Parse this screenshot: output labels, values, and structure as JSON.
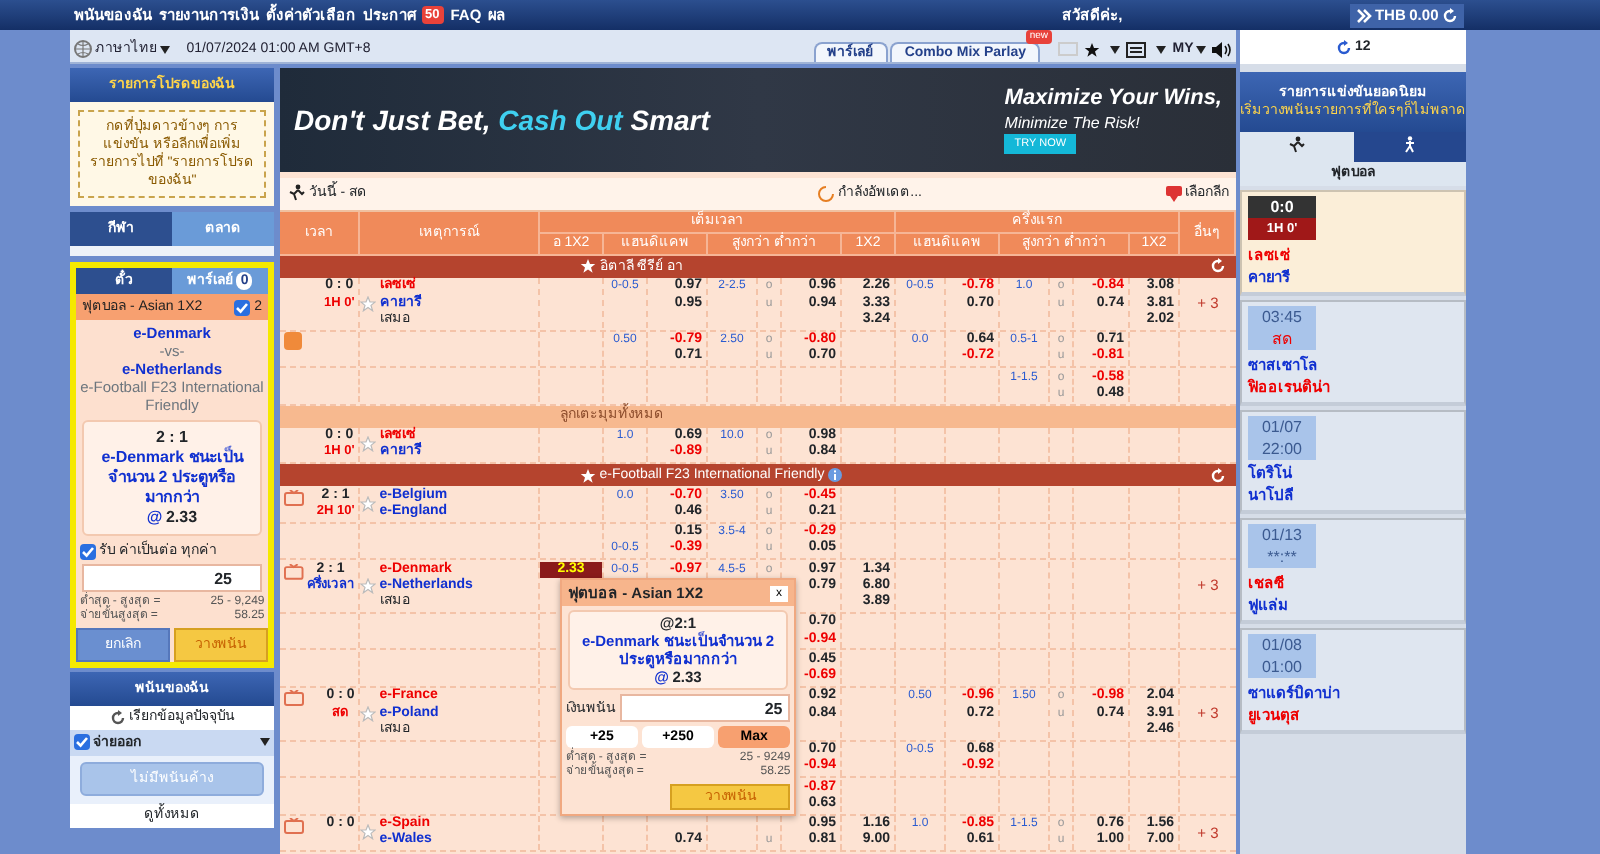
{
  "top_nav": {
    "items": [
      {
        "label": "พนันของฉัน"
      },
      {
        "label": "รายงานการเงิน"
      },
      {
        "label": "ตั้งค่าตัวเลือก"
      },
      {
        "label": "ประกาศ",
        "badge": "50"
      },
      {
        "label": "FAQ"
      },
      {
        "label": "ผล"
      }
    ],
    "greeting": "สวัสดีค่ะ,",
    "currency": "THB",
    "balance": "0.00"
  },
  "toolbar": {
    "language": "ภาษาไทย",
    "datetime": "01/07/2024 01:00 AM GMT+8",
    "tabs": [
      {
        "label": "พาร์เลย์"
      },
      {
        "label": "Combo Mix Parlay",
        "badge": "new"
      }
    ],
    "odds_type": "MY"
  },
  "favorites": {
    "title": "รายการโปรดของฉัน",
    "hint": "กดที่ปุ่มดาวข้างๆ การแข่งขัน หรือลีกเพื่อเพิ่มรายการไปที่ \"รายการโปรดของฉัน\""
  },
  "sport_tabs": [
    {
      "label": "กีฬา",
      "selected": true
    },
    {
      "label": "ตลาด",
      "selected": false
    }
  ],
  "bet_slip": {
    "tabs": [
      {
        "label": "ตั๋ว",
        "selected": true
      },
      {
        "label": "พาร์เลย์",
        "selected": false,
        "count": "0"
      }
    ],
    "market": "ฟุตบอล - Asian 1X2",
    "checked": true,
    "count": "2",
    "home": "e-Denmark",
    "vs": "-vs-",
    "away": "e-Netherlands",
    "league": "e-Football F23 International Friendly",
    "score": "2 : 1",
    "selection": "e-Denmark ชนะเป็นจำนวน 2 ประตูหรือมากกว่า",
    "at": "@",
    "odds": "2.33",
    "accept_any_odds": {
      "label": "รับ ค่าเป็นต่อ ทุกค่า",
      "checked": true
    },
    "stake": "25",
    "limits": [
      {
        "label": "ต่ำสุด - สูงสุด =",
        "value": "25 - 9,249"
      },
      {
        "label": "จ่ายขั้นสูงสุด =",
        "value": "58.25"
      }
    ],
    "buttons": [
      "ยกเลิก",
      "วางพนัน"
    ]
  },
  "my_bets": {
    "title": "พนันของฉัน",
    "refresh": "เรียกข้อมูลปัจจุบัน",
    "filter": {
      "label": "จ่ายออก",
      "checked": true
    },
    "empty_button": "ไม่มีพนันค้าง",
    "view_all": "ดูทั้งหมด"
  },
  "banner": {
    "headline": "Don't Just Bet, ",
    "highlight": "Cash Out",
    "tail": " Smart",
    "slogan_1": "Maximize Your Wins,",
    "slogan_2": "Minimize The Risk!",
    "cta": "TRY NOW"
  },
  "events_bar": {
    "title": "วันนี้ - สด",
    "status": "กำลังอัพเดต...",
    "league_filter": "เลือกลีก"
  },
  "table": {
    "columns": {
      "time": "เวลา",
      "event": "เหตุการณ์",
      "full_time": "เต็มเวลา",
      "first_half": "ครึ่งแรก",
      "more": "อื่นๆ",
      "ft_sub": [
        "อ 1X2",
        "แฮนดิแคพ",
        "สูงกว่า ต่ำกว่า",
        "1X2"
      ],
      "ht_sub": [
        "แฮนดิแคพ",
        "สูงกว่า ต่ำกว่า",
        "1X2"
      ]
    },
    "rows": [
      {
        "kind": "league",
        "name": "อิตาลี ซีรีย์ อา",
        "info": false
      },
      {
        "kind": "match",
        "score": "0 : 0",
        "period": "1H 0'",
        "half_time": false,
        "tv": false,
        "teams": [
          {
            "name": "เลซเซ่",
            "favorite": true
          },
          {
            "name": "คายารี",
            "favorite": false
          }
        ],
        "draw": "เสมอ",
        "more": "+ 3",
        "lines": [
          {
            "has_badge": false,
            "hdp": [
              {
                "line": "0-0.5",
                "odds": "0.97"
              },
              {
                "odds": "0.95"
              }
            ],
            "ou": [
              {
                "line": "2-2.5",
                "side": "o",
                "odds": "0.96"
              },
              {
                "side": "u",
                "odds": "0.94"
              }
            ],
            "x12": [
              "2.26",
              "3.33",
              "3.24"
            ],
            "ht_hdp": [
              {
                "line": "0-0.5",
                "odds": "-0.78"
              },
              {
                "odds": "0.70"
              }
            ],
            "ht_ou": [
              {
                "line": "1.0",
                "side": "o",
                "odds": "-0.84"
              },
              {
                "side": "u",
                "odds": "0.74"
              }
            ],
            "ht_x12": [
              "3.08",
              "3.81",
              "2.02"
            ]
          },
          {
            "has_badge": true,
            "hdp": [
              {
                "line": "0.50",
                "odds": "-0.79"
              },
              {
                "odds": "0.71"
              }
            ],
            "ou": [
              {
                "line": "2.50",
                "side": "o",
                "odds": "-0.80"
              },
              {
                "side": "u",
                "odds": "0.70"
              }
            ],
            "ht_hdp": [
              {
                "line": "0.0",
                "odds": "0.64"
              },
              {
                "odds": "-0.72"
              }
            ],
            "ht_ou": [
              {
                "line": "0.5-1",
                "side": "o",
                "odds": "0.71"
              },
              {
                "side": "u",
                "odds": "-0.81"
              }
            ]
          },
          {
            "has_badge": false,
            "ht_ou": [
              {
                "line": "1-1.5",
                "side": "o",
                "odds": "-0.58"
              },
              {
                "side": "u",
                "odds": "0.48"
              }
            ]
          }
        ]
      },
      {
        "kind": "band",
        "name": "ลูกเตะมุมทั้งหมด"
      },
      {
        "kind": "match",
        "score": "0 : 0",
        "period": "1H 0'",
        "half_time": false,
        "tv": false,
        "teams": [
          {
            "name": "เลซเซ่",
            "favorite": true
          },
          {
            "name": "คายารี",
            "favorite": false
          }
        ],
        "lines": [
          {
            "has_badge": false,
            "hdp": [
              {
                "line": "1.0",
                "odds": "0.69"
              },
              {
                "odds": "-0.89"
              }
            ],
            "ou": [
              {
                "line": "10.0",
                "side": "o",
                "odds": "0.98"
              },
              {
                "side": "u",
                "odds": "0.84"
              }
            ]
          }
        ]
      },
      {
        "kind": "league",
        "name": "e-Football F23 International Friendly",
        "info": true
      },
      {
        "kind": "match",
        "score": "2 : 1",
        "period": "2H 10'",
        "half_time": false,
        "tv": true,
        "teams": [
          {
            "name": "e-Belgium",
            "favorite": false
          },
          {
            "name": "e-England",
            "favorite": false
          }
        ],
        "lines": [
          {
            "has_badge": false,
            "hdp": [
              {
                "line": "0.0",
                "odds": "-0.70"
              },
              {
                "odds": "0.46"
              }
            ],
            "ou": [
              {
                "line": "3.50",
                "side": "o",
                "odds": "-0.45"
              },
              {
                "side": "u",
                "odds": "0.21"
              }
            ]
          },
          {
            "has_badge": false,
            "hdp": [
              {
                "odds": "0.15"
              },
              {
                "line": "0-0.5",
                "odds": "-0.39"
              }
            ],
            "ou": [
              {
                "line": "3.5-4",
                "side": "o",
                "odds": "-0.29"
              },
              {
                "side": "u",
                "odds": "0.05"
              }
            ]
          }
        ]
      },
      {
        "kind": "match",
        "score": "2 : 1",
        "period": "ครึ่งเวลา",
        "half_time": true,
        "tv": true,
        "teams": [
          {
            "name": "e-Denmark",
            "favorite": true
          },
          {
            "name": "e-Netherlands",
            "favorite": false
          }
        ],
        "draw": "เสมอ",
        "more": "+ 3",
        "lines": [
          {
            "has_badge": false,
            "pick": {
              "value": "2.33",
              "selected": true
            },
            "hdp": [
              {
                "line": "0-0.5",
                "odds": "-0.97"
              }
            ],
            "ou": [
              {
                "line": "4.5-5",
                "side": "o",
                "odds": "0.97"
              },
              {
                "odds": "0.79"
              }
            ],
            "x12": [
              "1.34",
              "6.80",
              "3.89"
            ]
          },
          {
            "has_badge": false,
            "ou": [
              {
                "odds": "0.70"
              },
              {
                "odds": "-0.94"
              }
            ]
          },
          {
            "has_badge": false,
            "ou": [
              {
                "odds": "0.45"
              },
              {
                "odds": "-0.69"
              }
            ]
          }
        ]
      },
      {
        "kind": "match",
        "score": "0 : 0",
        "period": "สด",
        "half_time": false,
        "tv": true,
        "teams": [
          {
            "name": "e-France",
            "favorite": true
          },
          {
            "name": "e-Poland",
            "favorite": false
          }
        ],
        "draw": "เสมอ",
        "more": "+ 3",
        "lines": [
          {
            "has_badge": false,
            "ou": [
              {
                "odds": "0.92"
              },
              {
                "odds": "0.84"
              }
            ],
            "ht_hdp": [
              {
                "line": "0.50",
                "odds": "-0.96"
              },
              {
                "odds": "0.72"
              }
            ],
            "ht_ou": [
              {
                "line": "1.50",
                "side": "o",
                "odds": "-0.98"
              },
              {
                "side": "u",
                "odds": "0.74"
              }
            ],
            "ht_x12": [
              "2.04",
              "3.91",
              "2.46"
            ]
          },
          {
            "has_badge": false,
            "ou": [
              {
                "odds": "0.70"
              },
              {
                "odds": "-0.94"
              }
            ],
            "ht_hdp": [
              {
                "line": "0-0.5",
                "odds": "0.68"
              },
              {
                "odds": "-0.92"
              }
            ]
          },
          {
            "has_badge": false,
            "ou": [
              {
                "odds": "-0.87"
              },
              {
                "odds": "0.63"
              }
            ]
          }
        ]
      },
      {
        "kind": "match",
        "score": "0 : 0",
        "tv": true,
        "teams": [
          {
            "name": "e-Spain",
            "favorite": true
          },
          {
            "name": "e-Wales",
            "favorite": false
          }
        ],
        "more": "+ 3",
        "lines": [
          {
            "has_badge": false,
            "hdp": [
              {
                "lower": true,
                "odds": "0.74"
              }
            ],
            "ou": [
              {
                "odds": "0.95"
              },
              {
                "side": "u",
                "odds": "0.81"
              }
            ],
            "x12": [
              "1.16",
              "9.00"
            ],
            "ht_hdp": [
              {
                "line": "1.0",
                "odds": "-0.85"
              },
              {
                "odds": "0.61"
              }
            ],
            "ht_ou": [
              {
                "line": "1-1.5",
                "side": "o",
                "odds": "0.76"
              },
              {
                "side": "u",
                "odds": "1.00"
              }
            ],
            "ht_x12": [
              "1.56",
              "7.00"
            ]
          }
        ]
      }
    ]
  },
  "popup": {
    "title": "ฟุตบอล - Asian 1X2",
    "close": "x",
    "score": "@2:1",
    "selection": "e-Denmark ชนะเป็นจำนวน 2 ประตูหรือมากกว่า",
    "at": "@",
    "odds": "2.33",
    "stake_label": "เงินพนัน",
    "stake": "25",
    "quick": [
      "+25",
      "+250",
      "Max"
    ],
    "limits": [
      {
        "label": "ต่ำสุด - สูงสุด =",
        "value": "25 - 9249"
      },
      {
        "label": "จ่ายขั้นสูงสุด =",
        "value": "58.25"
      }
    ],
    "submit": "วางพนัน"
  },
  "popular": {
    "refresh_count": "12",
    "title": "รายการแข่งขันยอดนิยม",
    "subtitle": "เริ่มวางพนันรายการที่ใครๆก็ไม่พลาด",
    "tabs": [
      {
        "kind": "soccer",
        "selected": true
      },
      {
        "kind": "runner",
        "selected": false
      }
    ],
    "sport": "ฟุตบอล",
    "matches": [
      {
        "kind": "live",
        "time": "0:0",
        "status": "1H 0'",
        "teams": [
          {
            "name": "เลซเซ่",
            "favorite": true
          },
          {
            "name": "คายารี",
            "favorite": false
          }
        ]
      },
      {
        "kind": "scheduled",
        "time": "03:45",
        "status": "สด",
        "status_live": true,
        "teams": [
          {
            "name": "ซาสเซาโล",
            "favorite": false
          },
          {
            "name": "ฟิออเรนติน่า",
            "favorite": true
          }
        ]
      },
      {
        "kind": "scheduled",
        "time": "01/07",
        "status": "22:00",
        "status_live": false,
        "teams": [
          {
            "name": "โตริโน่",
            "favorite": false
          },
          {
            "name": "นาโปลี",
            "favorite": false
          }
        ]
      },
      {
        "kind": "scheduled",
        "time": "01/13",
        "status": "**:**",
        "status_live": false,
        "teams": [
          {
            "name": "เชลซี",
            "favorite": true
          },
          {
            "name": "ฟูแล่ม",
            "favorite": false
          }
        ]
      },
      {
        "kind": "scheduled",
        "time": "01/08",
        "status": "01:00",
        "status_live": false,
        "teams": [
          {
            "name": "ซาแดร์บิดาบ่า",
            "favorite": false
          },
          {
            "name": "ยูเวนตุส",
            "favorite": true
          }
        ]
      }
    ]
  }
}
